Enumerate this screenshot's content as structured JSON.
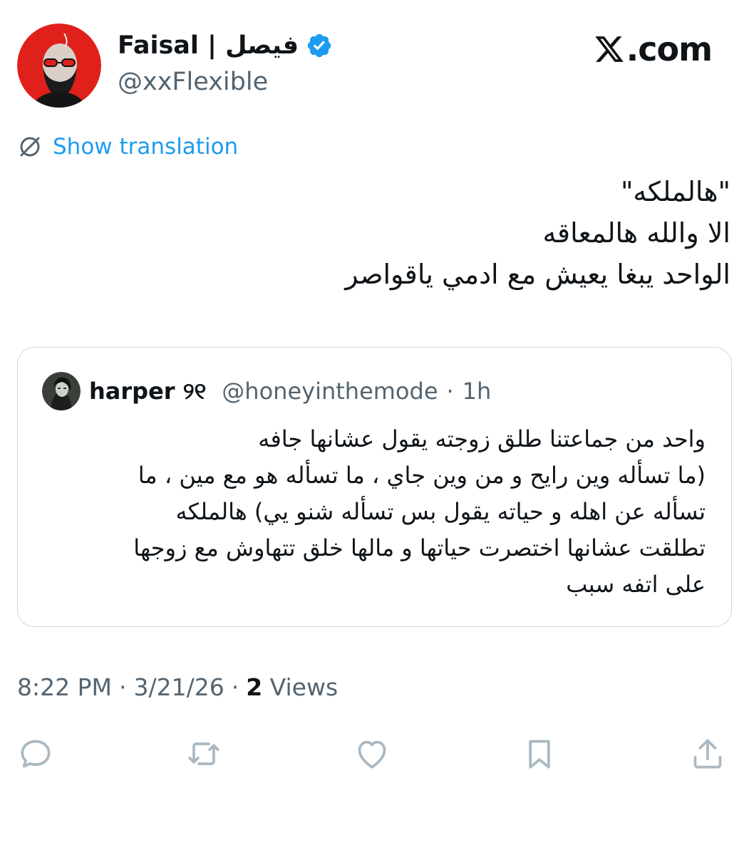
{
  "author": {
    "display_name": "Faisal | فيصل",
    "handle": "@xxFlexible",
    "verified_icon": "verified-badge-icon",
    "avatar_icon": "avatar"
  },
  "brand": {
    "text": ".com",
    "logo_icon": "x-logo-icon"
  },
  "translate": {
    "label": "Show translation",
    "icon": "translate-icon"
  },
  "tweet": {
    "lines": [
      "\"هالملكه\"",
      "الا والله هالمعاقه",
      "الواحد يبغا يعيش مع ادمي ياقواصر"
    ]
  },
  "quote": {
    "name": "harper ୨୧",
    "handle": "@honeyinthemode",
    "separator": "·",
    "time": "1h",
    "lines": [
      "واحد من جماعتنا طلق زوجته يقول عشانها جافه",
      "(ما تسأله وين رايح و من وين جاي ، ما تسأله هو مع مين ، ما",
      "تسأله عن اهله و حياته يقول بس تسأله شنو يي) هالملكه",
      "تطلقت عشانها اختصرت حياتها و مالها خلق تتهاوش مع زوجها",
      "على اتفه سبب"
    ]
  },
  "meta": {
    "time": "8:22 PM",
    "sep1": "·",
    "date": "3/21/26",
    "sep2": "·",
    "views_count": "2",
    "views_label": "Views"
  },
  "actions": [
    "reply-icon",
    "retweet-icon",
    "like-icon",
    "bookmark-icon",
    "share-icon"
  ],
  "colors": {
    "accent": "#1d9bf0",
    "secondary_text": "#536471",
    "border": "#cfd9de",
    "icon": "#aab8c2"
  }
}
